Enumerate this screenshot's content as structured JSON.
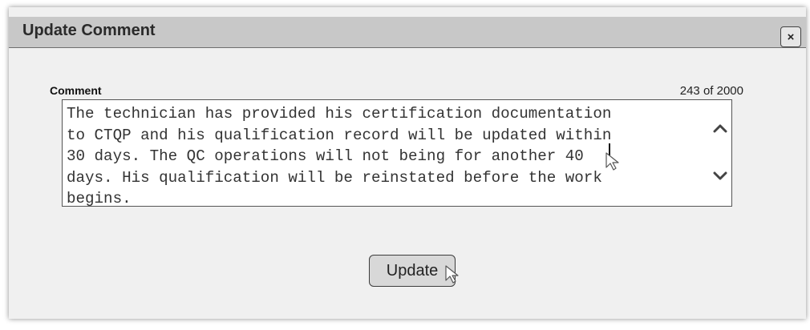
{
  "dialog": {
    "title": "Update Comment",
    "close_icon": "close-icon",
    "close_glyph": "×"
  },
  "comment": {
    "label": "Comment",
    "counter": "243 of 2000",
    "text_lines": [
      "The technician has provided his certification documentation",
      "to CTQP and his qualification record will be updated within",
      "30 days. The QC operations will not being for another 40",
      "days. His qualification will be reinstated before the work",
      "begins."
    ],
    "scroll_up_icon": "chevron-up-icon",
    "scroll_down_icon": "chevron-down-icon"
  },
  "actions": {
    "update_label": "Update"
  },
  "cursors": {
    "icon": "mouse-pointer-icon"
  }
}
